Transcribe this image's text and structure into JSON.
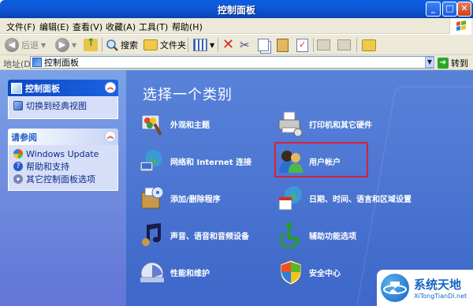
{
  "window": {
    "title": "控制面板"
  },
  "menu": {
    "items": [
      "文件(F)",
      "编辑(E)",
      "查看(V)",
      "收藏(A)",
      "工具(T)",
      "帮助(H)"
    ]
  },
  "toolbar": {
    "back": "后退",
    "search": "搜索",
    "folders": "文件夹"
  },
  "address": {
    "label": "地址(D)",
    "value": "控制面板",
    "go": "转到"
  },
  "sidebar": {
    "panel1": {
      "title": "控制面板",
      "items": [
        "切换到经典视图"
      ]
    },
    "panel2": {
      "title": "请参阅",
      "items": [
        "Windows Update",
        "帮助和支持",
        "其它控制面板选项"
      ]
    }
  },
  "main": {
    "heading": "选择一个类别",
    "categories": [
      {
        "label": "外观和主题",
        "icon": "appearance-icon"
      },
      {
        "label": "打印机和其它硬件",
        "icon": "printer-icon"
      },
      {
        "label": "网络和 Internet 连接",
        "icon": "network-icon"
      },
      {
        "label": "用户帐户",
        "icon": "user-accounts-icon"
      },
      {
        "label": "添加/删除程序",
        "icon": "add-remove-icon"
      },
      {
        "label": "日期、时间、语言和区域设置",
        "icon": "date-time-icon"
      },
      {
        "label": "声音、语音和音频设备",
        "icon": "sound-icon"
      },
      {
        "label": "辅助功能选项",
        "icon": "accessibility-icon"
      },
      {
        "label": "性能和维护",
        "icon": "performance-icon"
      },
      {
        "label": "安全中心",
        "icon": "security-icon"
      }
    ]
  },
  "watermark": {
    "title": "系统天地",
    "subtitle": "XiTongTianDi.net"
  }
}
